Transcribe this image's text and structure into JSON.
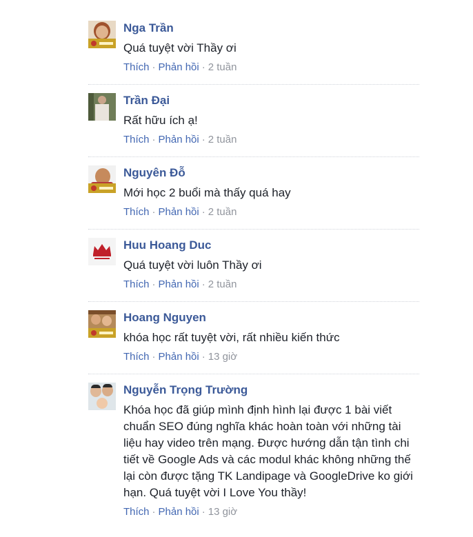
{
  "action_labels": {
    "like": "Thích",
    "reply": "Phản hồi",
    "sep": "·"
  },
  "comments": [
    {
      "name": "Nga Trần",
      "text": "Quá tuyệt vời Thầy ơi",
      "time": "2 tuần"
    },
    {
      "name": "Trần Đại",
      "text": "Rất hữu ích ạ!",
      "time": "2 tuần"
    },
    {
      "name": "Nguyên Đỗ",
      "text": "Mới học 2 buổi mà thấy quá hay",
      "time": "2 tuần"
    },
    {
      "name": "Huu Hoang Duc",
      "text": "Quá tuyệt vời luôn Thầy ơi",
      "time": "2 tuần"
    },
    {
      "name": "Hoang Nguyen",
      "text": "khóa học rất tuyệt vời, rất nhiều kiến thức",
      "time": "13 giờ"
    },
    {
      "name": "Nguyễn Trọng Trường",
      "text": "Khóa học đã giúp mình định hình lại được 1 bài viết chuẩn SEO đúng nghĩa khác hoàn toàn với những tài liệu hay video trên mạng. Được hướng dẫn tận tình chi tiết về Google Ads và các modul khác không những thế lại còn được tặng TK Landipage và GoogleDrive ko giới hạn. Quá tuyệt vời I Love You thầy!",
      "time": "13 giờ"
    }
  ],
  "colors": {
    "name": "#3b5998",
    "link": "#4267b2",
    "meta": "#90949c",
    "text": "#1d2129"
  }
}
